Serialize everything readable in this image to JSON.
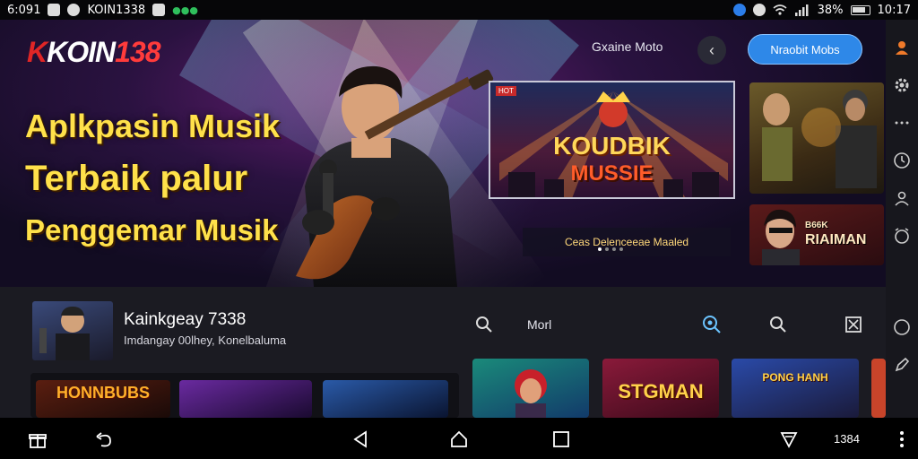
{
  "status_bar": {
    "time_left": "6:091",
    "app_name": "KOIN1338",
    "battery": "38%",
    "time_right": "10:17"
  },
  "hero": {
    "logo_k": "K",
    "logo_text": "KOIN",
    "logo_num": "138",
    "headline": [
      "Aplkpasin Musik",
      "Terbaik palur",
      "Penggemar Musik"
    ],
    "nav_label": "Gxaine Moto",
    "cta_label": "Nraobit Mobs",
    "featured": {
      "badge": "HOT",
      "title_top": "KOUDBIK",
      "title_bottom": "MUSSIE"
    },
    "side_card_text": [
      "RIAIMAN",
      "B66K"
    ],
    "caption": "Ceas Delenceeae Maaled"
  },
  "profile": {
    "name": "Kainkgeay 7338",
    "subtitle": "Imdangay 00lhey, Konelbaluma"
  },
  "toolbar": {
    "label": "Morl"
  },
  "games": [
    {
      "title": "HONNBUBS"
    },
    {
      "title": ""
    },
    {
      "title": ""
    },
    {
      "title": ""
    },
    {
      "title": "STGMAN"
    },
    {
      "title": "PONG HANH"
    }
  ],
  "nav": {
    "right_text": "1384"
  },
  "colors": {
    "accent": "#2e88e8",
    "headline": "#ffe14a",
    "logo_red": "#e02626"
  }
}
